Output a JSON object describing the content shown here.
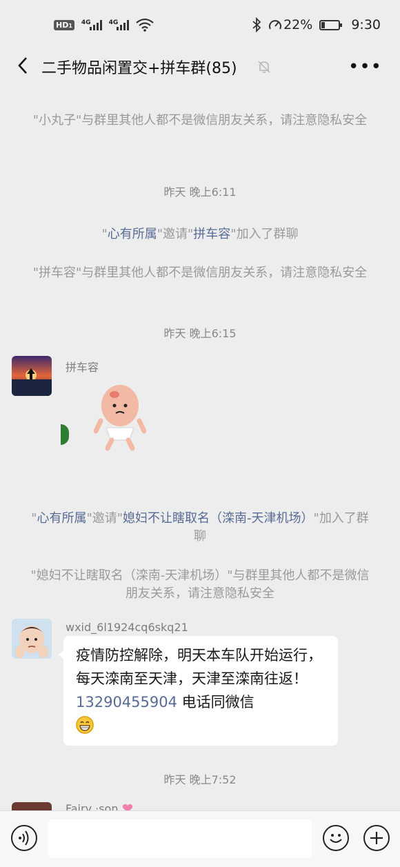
{
  "status_bar": {
    "hd_label": "HD",
    "hd_sub": "1",
    "net1": "4G",
    "net2": "4G",
    "battery_percent_text": "22%",
    "battery_level": 0.22,
    "time": "9:30"
  },
  "header": {
    "back_icon": "chevron-left-icon",
    "title": "二手物品闲置交+拼车群(85)",
    "mute_icon": "bell-off-icon",
    "more_label": "•••"
  },
  "messages": {
    "sys1": {
      "q1": "\"",
      "name": "小丸子",
      "q2": "\"",
      "text": "与群里其他人都不是微信朋友关系，请注意隐私安全"
    },
    "time1": "昨天 晚上6:11",
    "sys2": {
      "q1": "\"",
      "inviter": "心有所属",
      "q2": "\"",
      "verb": "邀请",
      "q3": "\"",
      "invitee": "拼车容",
      "q4": "\"",
      "tail": "加入了群聊"
    },
    "sys3": {
      "q1": "\"",
      "name": "拼车容",
      "q2": "\"",
      "text": "与群里其他人都不是微信朋友关系，请注意隐私安全"
    },
    "time2": "昨天 晚上6:15",
    "msg1": {
      "sender": "拼车容",
      "avatar_icon": "sunset-avatar-icon",
      "sticker_icon": "baby-sticker-icon"
    },
    "sys4": {
      "q1": "\"",
      "inviter": "心有所属",
      "q2": "\"",
      "verb": "邀请",
      "q3": "\"",
      "invitee": "媳妇不让瞎取名（滦南-天津机场）",
      "q4": "\"",
      "tail": "加入了群聊"
    },
    "sys5": {
      "q1": "\"",
      "name": "媳妇不让瞎取名（滦南-天津机场）",
      "q2": "\"",
      "text": "与群里其他人都不是微信朋友关系，请注意隐私安全"
    },
    "msg2": {
      "sender": "wxid_6l1924cq6skq21",
      "avatar_icon": "child-avatar-icon",
      "text_before": "疫情防控解除，明天本车队开始运行，每天滦南至天津，天津至滦南往返！",
      "phone": "13290455904",
      "text_after": " 电话同微信",
      "emoji_icon": "grin-emoji-icon"
    },
    "time3": "昨天 晚上7:52",
    "msg3": {
      "sender": "Fairy ·son",
      "avatar_icon": "woman-avatar-icon",
      "heart_icon": "heart-icon"
    }
  },
  "input_bar": {
    "voice_icon": "voice-icon",
    "input_value": "",
    "emoji_icon": "smile-icon",
    "plus_icon": "plus-icon"
  },
  "colors": {
    "background": "#ededed",
    "link": "#576b95",
    "system_text": "#9a9a9a"
  }
}
